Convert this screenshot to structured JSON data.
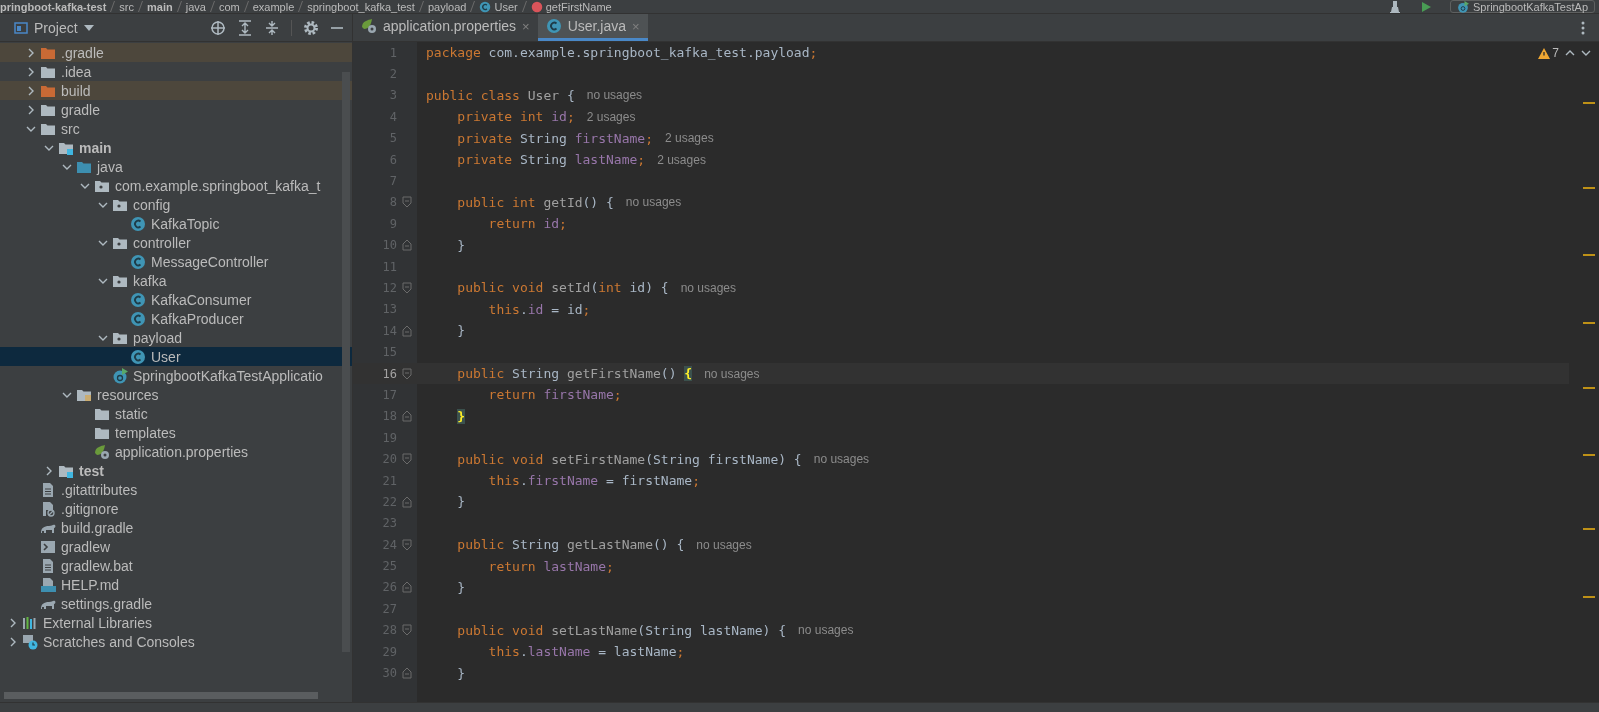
{
  "breadcrumbs": [
    {
      "label": "pringboot-kafka-test",
      "bold": true
    },
    {
      "label": "src",
      "bold": false
    },
    {
      "label": "main",
      "bold": true
    },
    {
      "label": "java",
      "bold": false
    },
    {
      "label": "com",
      "bold": false
    },
    {
      "label": "example",
      "bold": false
    },
    {
      "label": "springboot_kafka_test",
      "bold": false
    },
    {
      "label": "payload",
      "bold": false
    },
    {
      "label": "User",
      "bold": false,
      "kind": "class"
    },
    {
      "label": "getFirstName",
      "bold": false,
      "kind": "method"
    }
  ],
  "run_config": "SpringbootKafkaTestAp",
  "project_panel": {
    "title": "Project",
    "project_items": [
      {
        "name": ".gradle",
        "kind": "folder-excluded",
        "expanded": false,
        "bold": false,
        "selected": false,
        "excluded": true
      },
      {
        "name": ".idea",
        "kind": "folder",
        "expanded": false,
        "bold": false,
        "selected": false,
        "excluded": false
      },
      {
        "name": "build",
        "kind": "folder-excluded",
        "expanded": false,
        "bold": false,
        "selected": false,
        "excluded": true
      },
      {
        "name": "gradle",
        "kind": "folder",
        "expanded": false,
        "bold": false,
        "selected": false,
        "excluded": false
      },
      {
        "name": "src",
        "kind": "folder",
        "expanded": true,
        "bold": false,
        "selected": false,
        "excluded": false,
        "children": [
          {
            "name": "main",
            "kind": "module",
            "expanded": true,
            "bold": true,
            "selected": false,
            "excluded": false,
            "children": [
              {
                "name": "java",
                "kind": "source",
                "expanded": true,
                "bold": false,
                "selected": false,
                "excluded": false,
                "children": [
                  {
                    "name": "com.example.springboot_kafka_t",
                    "kind": "package",
                    "expanded": true,
                    "bold": false,
                    "selected": false,
                    "excluded": false,
                    "children": [
                      {
                        "name": "config",
                        "kind": "package",
                        "expanded": true,
                        "bold": false,
                        "selected": false,
                        "excluded": false,
                        "children": [
                          {
                            "name": "KafkaTopic",
                            "kind": "class",
                            "bold": false,
                            "selected": false,
                            "excluded": false
                          }
                        ]
                      },
                      {
                        "name": "controller",
                        "kind": "package",
                        "expanded": true,
                        "bold": false,
                        "selected": false,
                        "excluded": false,
                        "children": [
                          {
                            "name": "MessageController",
                            "kind": "class",
                            "bold": false,
                            "selected": false,
                            "excluded": false
                          }
                        ]
                      },
                      {
                        "name": "kafka",
                        "kind": "package",
                        "expanded": true,
                        "bold": false,
                        "selected": false,
                        "excluded": false,
                        "children": [
                          {
                            "name": "KafkaConsumer",
                            "kind": "class",
                            "bold": false,
                            "selected": false,
                            "excluded": false
                          },
                          {
                            "name": "KafkaProducer",
                            "kind": "class",
                            "bold": false,
                            "selected": false,
                            "excluded": false
                          }
                        ]
                      },
                      {
                        "name": "payload",
                        "kind": "package",
                        "expanded": true,
                        "bold": false,
                        "selected": false,
                        "excluded": false,
                        "children": [
                          {
                            "name": "User",
                            "kind": "class",
                            "bold": false,
                            "selected": true,
                            "excluded": false
                          }
                        ]
                      },
                      {
                        "name": "SpringbootKafkaTestApplicatio",
                        "kind": "spring-app",
                        "bold": false,
                        "selected": false,
                        "excluded": false
                      }
                    ]
                  }
                ]
              },
              {
                "name": "resources",
                "kind": "resources",
                "expanded": true,
                "bold": false,
                "selected": false,
                "excluded": false,
                "children": [
                  {
                    "name": "static",
                    "kind": "folder",
                    "bold": false,
                    "selected": false,
                    "excluded": false
                  },
                  {
                    "name": "templates",
                    "kind": "folder",
                    "bold": false,
                    "selected": false,
                    "excluded": false
                  },
                  {
                    "name": "application.properties",
                    "kind": "properties",
                    "bold": false,
                    "selected": false,
                    "excluded": false
                  }
                ]
              }
            ]
          },
          {
            "name": "test",
            "kind": "module",
            "expanded": false,
            "bold": true,
            "selected": false,
            "excluded": false
          }
        ]
      },
      {
        "name": ".gitattributes",
        "kind": "text-file",
        "bold": false,
        "selected": false,
        "excluded": false
      },
      {
        "name": ".gitignore",
        "kind": "ignore-file",
        "bold": false,
        "selected": false,
        "excluded": false
      },
      {
        "name": "build.gradle",
        "kind": "gradle",
        "bold": false,
        "selected": false,
        "excluded": false
      },
      {
        "name": "gradlew",
        "kind": "shell",
        "bold": false,
        "selected": false,
        "excluded": false
      },
      {
        "name": "gradlew.bat",
        "kind": "text-file",
        "bold": false,
        "selected": false,
        "excluded": false
      },
      {
        "name": "HELP.md",
        "kind": "markdown",
        "bold": false,
        "selected": false,
        "excluded": false
      },
      {
        "name": "settings.gradle",
        "kind": "gradle",
        "bold": false,
        "selected": false,
        "excluded": false
      }
    ],
    "root_items": [
      {
        "name": "External Libraries",
        "kind": "libraries",
        "expanded": false,
        "bold": false,
        "selected": false,
        "excluded": false
      },
      {
        "name": "Scratches and Consoles",
        "kind": "scratches",
        "expanded": false,
        "bold": false,
        "selected": false,
        "excluded": false
      }
    ]
  },
  "tabs": [
    {
      "label": "application.properties",
      "kind": "properties",
      "selected": false,
      "close": "×"
    },
    {
      "label": "User.java",
      "kind": "class",
      "selected": true,
      "close": "×"
    }
  ],
  "inspections": {
    "warnings": "7"
  },
  "code_lines": [
    {
      "number": "1",
      "tokens": [
        {
          "kind": "kw",
          "t": "package"
        },
        {
          "kind": "plain",
          "t": " com.example.springboot_kafka_test.payload"
        },
        {
          "kind": "kw",
          "t": ";"
        }
      ]
    },
    {
      "number": "2"
    },
    {
      "number": "3",
      "tokens": [
        {
          "kind": "kw",
          "t": "public class "
        },
        {
          "kind": "decl",
          "t": "User"
        },
        {
          "kind": "plain",
          "t": " {"
        }
      ],
      "hint": "no usages"
    },
    {
      "number": "4",
      "tokens": [
        {
          "kind": "kw",
          "t": "    private int "
        },
        {
          "kind": "field",
          "t": "id"
        },
        {
          "kind": "kw",
          "t": ";"
        }
      ],
      "hint": "2 usages"
    },
    {
      "number": "5",
      "tokens": [
        {
          "kind": "kw",
          "t": "    private "
        },
        {
          "kind": "plain",
          "t": "String "
        },
        {
          "kind": "field",
          "t": "firstName"
        },
        {
          "kind": "kw",
          "t": ";"
        }
      ],
      "hint": "2 usages"
    },
    {
      "number": "6",
      "tokens": [
        {
          "kind": "kw",
          "t": "    private "
        },
        {
          "kind": "plain",
          "t": "String "
        },
        {
          "kind": "field",
          "t": "lastName"
        },
        {
          "kind": "kw",
          "t": ";"
        }
      ],
      "hint": "2 usages"
    },
    {
      "number": "7"
    },
    {
      "number": "8",
      "kind": "fold-start",
      "tokens": [
        {
          "kind": "kw",
          "t": "    public int "
        },
        {
          "kind": "decl",
          "t": "getId"
        },
        {
          "kind": "plain",
          "t": "() {"
        }
      ],
      "hint": "no usages"
    },
    {
      "number": "9",
      "tokens": [
        {
          "kind": "kw",
          "t": "        return "
        },
        {
          "kind": "field",
          "t": "id"
        },
        {
          "kind": "kw",
          "t": ";"
        }
      ]
    },
    {
      "number": "10",
      "kind": "fold-end",
      "tokens": [
        {
          "kind": "plain",
          "t": "    }"
        }
      ]
    },
    {
      "number": "11"
    },
    {
      "number": "12",
      "kind": "fold-start",
      "tokens": [
        {
          "kind": "kw",
          "t": "    public void "
        },
        {
          "kind": "decl",
          "t": "setId"
        },
        {
          "kind": "plain",
          "t": "("
        },
        {
          "kind": "kw",
          "t": "int"
        },
        {
          "kind": "plain",
          "t": " id) {"
        }
      ],
      "hint": "no usages"
    },
    {
      "number": "13",
      "tokens": [
        {
          "kind": "kw",
          "t": "        this"
        },
        {
          "kind": "plain",
          "t": "."
        },
        {
          "kind": "field",
          "t": "id"
        },
        {
          "kind": "plain",
          "t": " = id"
        },
        {
          "kind": "kw",
          "t": ";"
        }
      ]
    },
    {
      "number": "14",
      "kind": "fold-end",
      "tokens": [
        {
          "kind": "plain",
          "t": "    }"
        }
      ]
    },
    {
      "number": "15"
    },
    {
      "number": "16",
      "kind": "fold-start",
      "current": true,
      "tokens": [
        {
          "kind": "kw",
          "t": "    public "
        },
        {
          "kind": "plain",
          "t": "String "
        },
        {
          "kind": "decl",
          "t": "getFirstName"
        },
        {
          "kind": "plain",
          "t": "() "
        },
        {
          "kind": "match",
          "t": "{"
        }
      ],
      "hint": "no usages"
    },
    {
      "number": "17",
      "tokens": [
        {
          "kind": "kw",
          "t": "        return "
        },
        {
          "kind": "field",
          "t": "firstName"
        },
        {
          "kind": "kw",
          "t": ";"
        }
      ]
    },
    {
      "number": "18",
      "kind": "fold-end",
      "tokens": [
        {
          "kind": "match",
          "t": "    }"
        }
      ]
    },
    {
      "number": "19"
    },
    {
      "number": "20",
      "kind": "fold-start",
      "tokens": [
        {
          "kind": "kw",
          "t": "    public void "
        },
        {
          "kind": "decl",
          "t": "setFirstName"
        },
        {
          "kind": "plain",
          "t": "(String firstName) {"
        }
      ],
      "hint": "no usages"
    },
    {
      "number": "21",
      "tokens": [
        {
          "kind": "kw",
          "t": "        this"
        },
        {
          "kind": "plain",
          "t": "."
        },
        {
          "kind": "field",
          "t": "firstName"
        },
        {
          "kind": "plain",
          "t": " = firstName"
        },
        {
          "kind": "kw",
          "t": ";"
        }
      ]
    },
    {
      "number": "22",
      "kind": "fold-end",
      "tokens": [
        {
          "kind": "plain",
          "t": "    }"
        }
      ]
    },
    {
      "number": "23"
    },
    {
      "number": "24",
      "kind": "fold-start",
      "tokens": [
        {
          "kind": "kw",
          "t": "    public "
        },
        {
          "kind": "plain",
          "t": "String "
        },
        {
          "kind": "decl",
          "t": "getLastName"
        },
        {
          "kind": "plain",
          "t": "() {"
        }
      ],
      "hint": "no usages"
    },
    {
      "number": "25",
      "tokens": [
        {
          "kind": "kw",
          "t": "        return "
        },
        {
          "kind": "field",
          "t": "lastName"
        },
        {
          "kind": "kw",
          "t": ";"
        }
      ]
    },
    {
      "number": "26",
      "kind": "fold-end",
      "tokens": [
        {
          "kind": "plain",
          "t": "    }"
        }
      ]
    },
    {
      "number": "27"
    },
    {
      "number": "28",
      "kind": "fold-start",
      "tokens": [
        {
          "kind": "kw",
          "t": "    public void "
        },
        {
          "kind": "decl",
          "t": "setLastName"
        },
        {
          "kind": "plain",
          "t": "(String lastName) {"
        }
      ],
      "hint": "no usages"
    },
    {
      "number": "29",
      "tokens": [
        {
          "kind": "kw",
          "t": "        this"
        },
        {
          "kind": "plain",
          "t": "."
        },
        {
          "kind": "field",
          "t": "lastName"
        },
        {
          "kind": "plain",
          "t": " = lastName"
        },
        {
          "kind": "kw",
          "t": ";"
        }
      ]
    },
    {
      "number": "30",
      "kind": "fold-end",
      "tokens": [
        {
          "kind": "plain",
          "t": "    }"
        }
      ]
    }
  ]
}
